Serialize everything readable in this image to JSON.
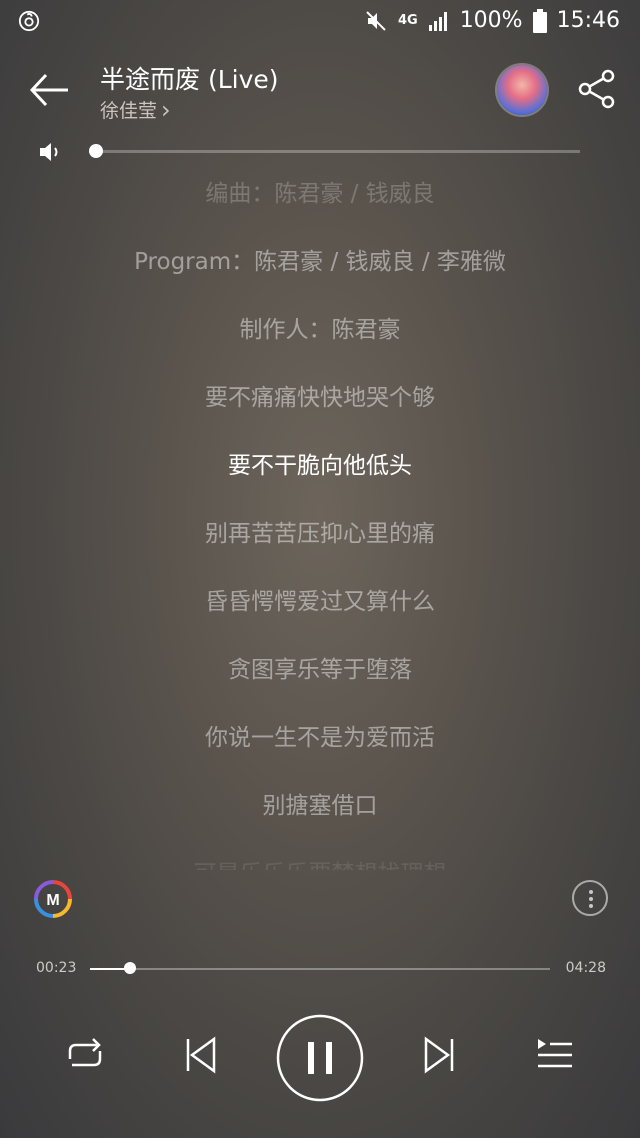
{
  "status_bar": {
    "network": "4G",
    "battery": "100%",
    "time": "15:46"
  },
  "header": {
    "title": "半途而废 (Live)",
    "artist": "徐佳莹",
    "artist_chevron": "›"
  },
  "lyrics": [
    "编曲：陈君豪 / 钱威良",
    "Program：陈君豪 / 钱威良 / 李雅微",
    "制作人：陈君豪",
    "要不痛痛快快地哭个够",
    "要不干脆向他低头",
    "别再苦苦压抑心里的痛",
    "昏昏愕愕爱过又算什么",
    "贪图享乐等于堕落",
    "你说一生不是为爱而活",
    "别搪塞借口",
    "可是乐乐乐要梦想找理想"
  ],
  "current_lyric_index": 4,
  "progress": {
    "current_time": "00:23",
    "total_time": "04:28",
    "fraction": 0.086
  },
  "volume": {
    "fraction": 0.0
  },
  "icons": {
    "app_logo": "netease-music-icon",
    "mute": "mute-icon",
    "back": "back-arrow-icon",
    "share": "share-icon",
    "volume": "volume-icon",
    "m_logo": "m-logo-icon",
    "more": "more-vertical-icon",
    "repeat": "repeat-icon",
    "prev": "previous-icon",
    "pause": "pause-icon",
    "next": "next-icon",
    "playlist": "playlist-icon"
  }
}
